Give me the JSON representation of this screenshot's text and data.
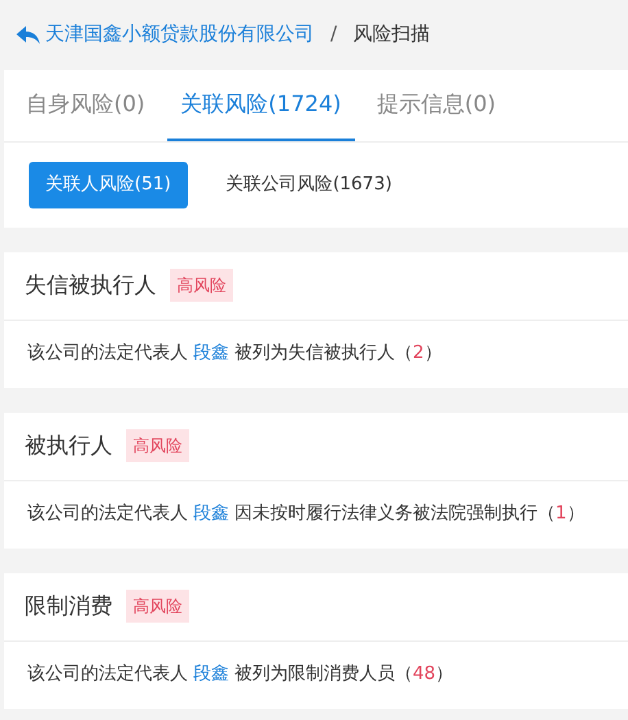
{
  "breadcrumb": {
    "company": "天津国鑫小额贷款股份有限公司",
    "separator": "/",
    "current": "风险扫描"
  },
  "tabs": [
    {
      "label": "自身风险(0)",
      "selected": false
    },
    {
      "label": "关联风险(1724)",
      "selected": true
    },
    {
      "label": "提示信息(0)",
      "selected": false
    }
  ],
  "subtabs": [
    {
      "label": "关联人风险(51)",
      "selected": true
    },
    {
      "label": "关联公司风险(1673)",
      "selected": false
    }
  ],
  "risks": [
    {
      "title": "失信被执行人",
      "tag": "高风险",
      "prefix": "该公司的法定代表人",
      "person": "段鑫",
      "suffix": "被列为失信被执行人（",
      "count": "2",
      "tail": "）"
    },
    {
      "title": "被执行人",
      "tag": "高风险",
      "prefix": "该公司的法定代表人",
      "person": "段鑫",
      "suffix": "因未按时履行法律义务被法院强制执行（",
      "count": "1",
      "tail": "）"
    },
    {
      "title": "限制消费",
      "tag": "高风险",
      "prefix": "该公司的法定代表人",
      "person": "段鑫",
      "suffix": "被列为限制消费人员（",
      "count": "48",
      "tail": "）"
    }
  ]
}
